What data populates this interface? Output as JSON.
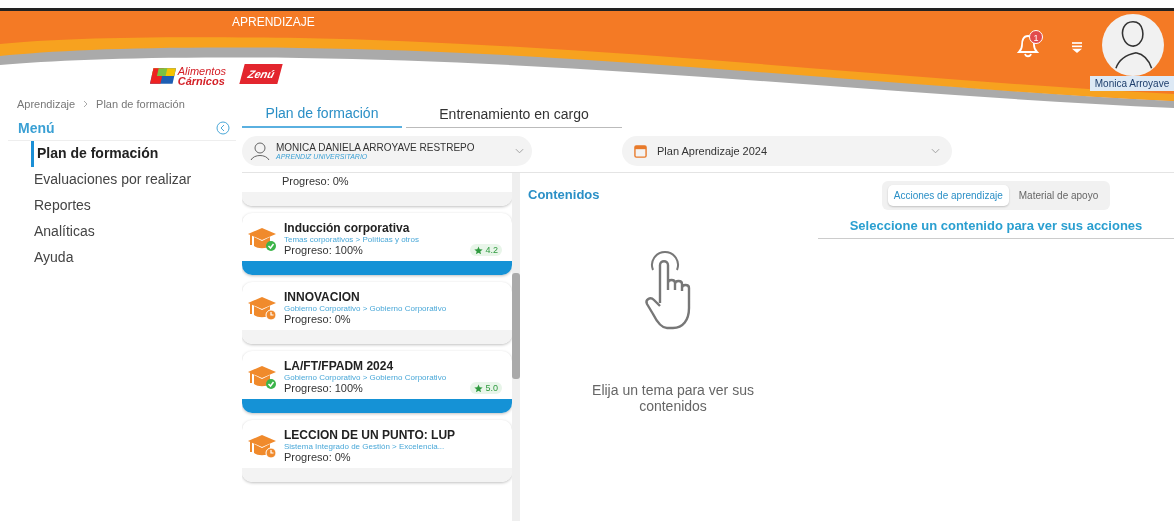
{
  "header": {
    "title": "APRENDIZAJE",
    "notifications": "1",
    "user_name": "Monica Arroyave"
  },
  "logos": {
    "company_line1": "Alimentos",
    "company_line2": "Cárnicos",
    "brand": "Zenú"
  },
  "breadcrumb": [
    "Aprendizaje",
    "Plan de formación"
  ],
  "sidebar": {
    "title": "Menú",
    "items": [
      {
        "label": "Plan de formación",
        "selected": true
      },
      {
        "label": "Evaluaciones por realizar",
        "selected": false
      },
      {
        "label": "Reportes",
        "selected": false
      },
      {
        "label": "Analíticas",
        "selected": false
      },
      {
        "label": "Ayuda",
        "selected": false
      }
    ]
  },
  "tabs": [
    {
      "label": "Plan de formación",
      "selected": true
    },
    {
      "label": "Entrenamiento en cargo",
      "selected": false
    }
  ],
  "person_select": {
    "name": "MONICA DANIELA ARROYAVE RESTREPO",
    "role": "APRENDIZ UNIVERSITARIO"
  },
  "plan_select": {
    "value": "Plan Aprendizaje 2024"
  },
  "courses": [
    {
      "kind": "partial",
      "progress": "Progreso: 0%",
      "completed": false
    },
    {
      "kind": "full",
      "title": "Inducción corporativa",
      "path": "Temas corporativos > Políticas y otros",
      "progress": "Progreso: 100%",
      "completed": true,
      "rating": "4.2"
    },
    {
      "kind": "full",
      "title": "INNOVACION",
      "path": "Gobierno Corporativo > Gobierno Corporativo",
      "progress": "Progreso: 0%",
      "completed": false
    },
    {
      "kind": "full",
      "title": "LA/FT/FPADM 2024",
      "path": "Gobierno Corporativo > Gobierno Corporativo",
      "progress": "Progreso: 100%",
      "completed": true,
      "rating": "5.0"
    },
    {
      "kind": "full",
      "title": "LECCION DE UN PUNTO: LUP",
      "path": "Sistema Integrado de Gestión > Excelencia...",
      "progress": "Progreso: 0%",
      "completed": false
    }
  ],
  "contents": {
    "title": "Contenidos",
    "empty_message": "Elija un tema para ver sus contenidos"
  },
  "actions": {
    "segments": [
      {
        "label": "Acciones de aprendizaje",
        "selected": true
      },
      {
        "label": "Material de apoyo",
        "selected": false
      }
    ],
    "message": "Seleccione un contenido para ver sus acciones"
  }
}
